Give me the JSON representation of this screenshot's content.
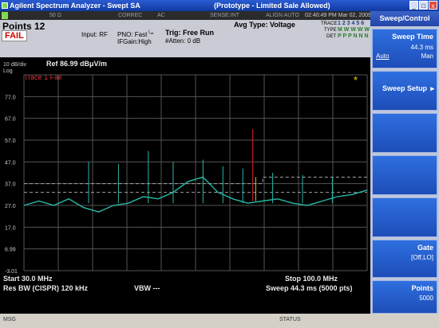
{
  "window": {
    "title": "Agilent Spectrum Analyzer - Swept SA",
    "subtitle": "(Prototype - Limited Sale Allowed)",
    "min_btn": "_",
    "max_btn": "□",
    "close_btn": "x"
  },
  "status_row": {
    "impedance": "50 Ω",
    "correc": "CORREC",
    "coupling": "AC",
    "sense": "SENSE:INT",
    "align": "ALIGN AUTO",
    "datetime": "02:40:49 PM Mar 02, 2009"
  },
  "info": {
    "points": "Points  12",
    "fail": "FAIL",
    "input": "Input: RF",
    "pno": "PNO: Fast",
    "ifgain": "IFGain:High",
    "trig": "Trig: Free Run",
    "atten": "#Atten: 0 dB",
    "avg_type": "Avg Type: Voltage",
    "trace_label": "TRACE",
    "type_label": "TYPE",
    "det_label": "DET",
    "trace_vals": "1 2 3 4 5 6",
    "type_vals": "M W W W W W",
    "det_vals": "P P P N N N"
  },
  "plot": {
    "scale": "10 dB/div",
    "scale_type": "Log",
    "ref": "Ref 86.99 dBμV/m",
    "trace_fail": "Trace 1 Fail",
    "marker_star": "*",
    "y_ticks": [
      "77.0",
      "67.0",
      "57.0",
      "47.0",
      "37.0",
      "27.0",
      "17.0",
      "6.99",
      "-3.01"
    ],
    "start": "Start 30.0 MHz",
    "stop": "Stop 100.0 MHz",
    "rbw": "Res BW (CISPR)  120 kHz",
    "vbw": "VBW ---",
    "sweep": "Sweep  44.3 ms (5000 pts)"
  },
  "chart_data": {
    "type": "line",
    "x": [
      30,
      33,
      36,
      39,
      42,
      45,
      48,
      51,
      54,
      57,
      60,
      63,
      66,
      69,
      72,
      75,
      78,
      81,
      84,
      87,
      90,
      93,
      96,
      99
    ],
    "series": [
      {
        "values": [
          27,
          29,
          27,
          30,
          26,
          24,
          27,
          28,
          31,
          30,
          33,
          38,
          40,
          33,
          30,
          28,
          29,
          30,
          28,
          27,
          29,
          31,
          32,
          34
        ]
      }
    ],
    "ylim": [
      -3.01,
      86.99
    ],
    "colors": {
      "trace": "#28b8a8",
      "limit": "#a0a0a0",
      "spike_red": "#c82020",
      "spike_yellow": "#d8c020"
    }
  },
  "sidebar": {
    "header": "Sweep/Control",
    "sweep_time_label": "Sweep Time",
    "sweep_time_value": "44.3 ms",
    "sweep_time_auto": "Auto",
    "sweep_time_man": "Man",
    "sweep_setup_label": "Sweep Setup",
    "sweep_setup_arrow": "▸",
    "gate_label": "Gate",
    "gate_value": "[Off,LO]",
    "points_label": "Points",
    "points_value": "5000"
  },
  "bottom": {
    "msg": "MSG",
    "status": "STATUS"
  }
}
